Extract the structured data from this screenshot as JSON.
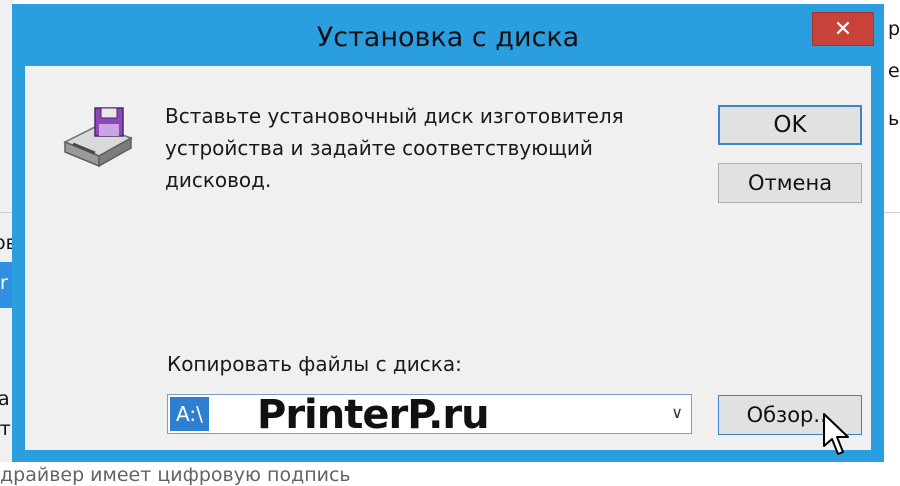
{
  "dialog": {
    "title": "Установка с диска",
    "close_glyph": "✕",
    "message_line1": "Вставьте установочный диск изготовителя",
    "message_line2": "устройства и задайте соответствующий дисковод.",
    "ok_label": "OK",
    "cancel_label": "Отмена",
    "copy_label": "Копировать файлы с диска:",
    "path_value": "A:\\",
    "browse_label": "Обзор...",
    "watermark": "PrinterP.ru",
    "icon": "floppy-drive-icon"
  },
  "background": {
    "left_fragments": [
      "ов",
      "r",
      "а",
      "ат"
    ],
    "right_fragments": [
      "р",
      "e",
      "ь"
    ],
    "bottom_text": "драйвер имеет цифровую подпись"
  },
  "colors": {
    "accent": "#2b9ee0",
    "close": "#c74238",
    "selection": "#2f7fd0"
  }
}
